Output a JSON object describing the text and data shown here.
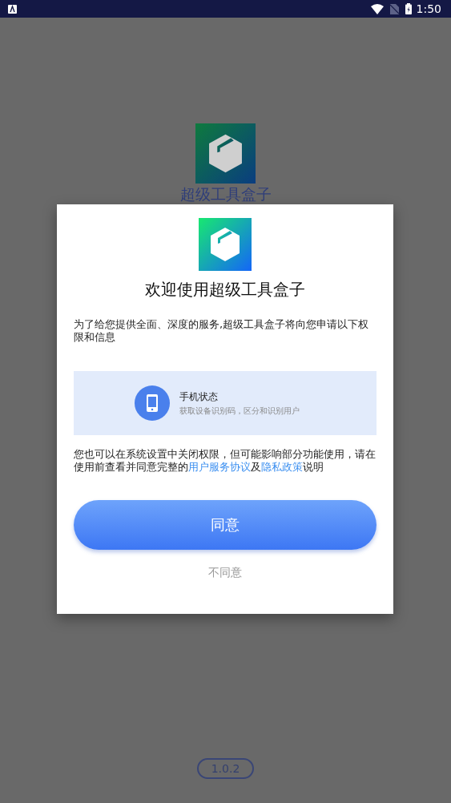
{
  "status_bar": {
    "time": "1:50"
  },
  "background": {
    "app_name": "超级工具盒子",
    "version": "1.0.2"
  },
  "dialog": {
    "title": "欢迎使用超级工具盒子",
    "intro": "为了给您提供全面、深度的服务,超级工具盒子将向您申请以下权限和信息",
    "permissions": [
      {
        "title": "手机状态",
        "description": "获取设备识别码，区分和识别用户"
      }
    ],
    "notice": [
      {
        "kind": "text",
        "text": "您也可以在系统设置中关闭权限，但可能影响部分功能使用，请在使用前查看并同意完整的"
      },
      {
        "kind": "link",
        "text": "用户服务协议"
      },
      {
        "kind": "text",
        "text": "及"
      },
      {
        "kind": "link",
        "text": "隐私政策"
      },
      {
        "kind": "text",
        "text": "说明"
      }
    ],
    "agree_button": "同意",
    "disagree_button": "不同意"
  }
}
